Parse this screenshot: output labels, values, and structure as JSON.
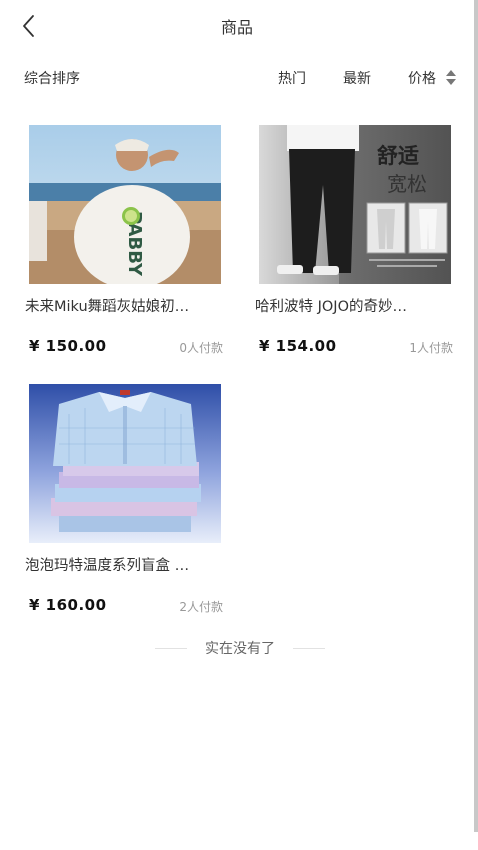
{
  "header": {
    "title": "商品"
  },
  "sortbar": {
    "default_label": "综合排序",
    "tabs": [
      "热门",
      "最新",
      "价格"
    ]
  },
  "products": [
    {
      "title": "未来Miku舞蹈灰姑娘初…",
      "price": "¥ 150.00",
      "sold": "0人付款",
      "image_text": "PABBY"
    },
    {
      "title": "哈利波特 JOJO的奇妙…",
      "price": "¥ 154.00",
      "sold": "1人付款",
      "image_text_1": "舒适",
      "image_text_2": "宽松"
    },
    {
      "title": "泡泡玛特温度系列盲盒 …",
      "price": "¥ 160.00",
      "sold": "2人付款"
    }
  ],
  "footer": {
    "end_text": "实在没有了"
  },
  "colors": {
    "text": "#333333",
    "muted": "#999999",
    "price": "#111111"
  }
}
